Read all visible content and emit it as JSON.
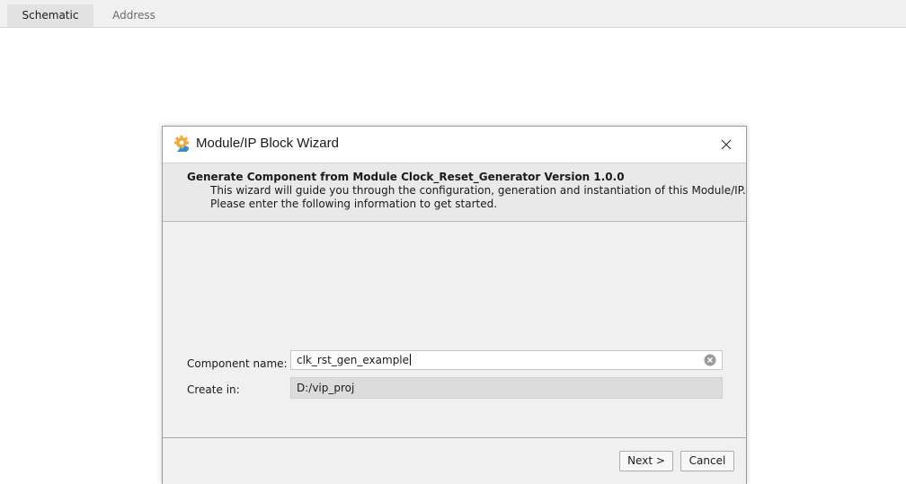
{
  "tabs": [
    {
      "label": "Schematic",
      "active": true
    },
    {
      "label": "Address",
      "active": false
    }
  ],
  "dialog": {
    "title": "Module/IP Block Wizard",
    "title_icon": "wizard-gear-icon",
    "header": {
      "title": "Generate Component from Module Clock_Reset_Generator Version 1.0.0",
      "line1": "This wizard will guide you through the configuration, generation and instantiation of this Module/IP.",
      "line2": "Please enter the following information to get started."
    },
    "fields": {
      "component_name_label": "Component name:",
      "component_name_value": "clk_rst_gen_example",
      "create_in_label": "Create in:",
      "create_in_value": "D:/vip_proj"
    },
    "buttons": {
      "next": "Next >",
      "cancel": "Cancel"
    }
  },
  "colors": {
    "dialog_bg": "#f0f0f0",
    "header_bg": "#e9e9e9",
    "icon_orange": "#f2a93b",
    "icon_blue": "#2f8fd8"
  }
}
